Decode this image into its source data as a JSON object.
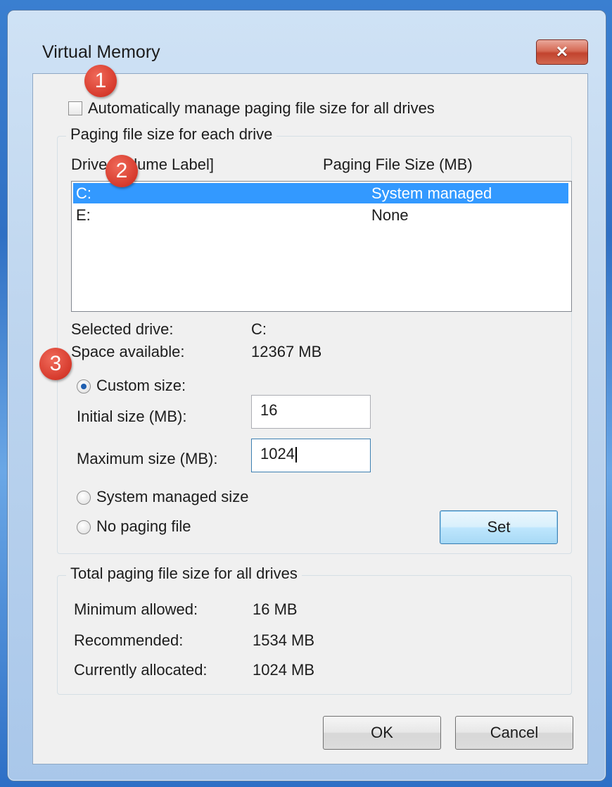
{
  "window": {
    "title": "Virtual Memory",
    "close_label": "✕"
  },
  "auto_manage": {
    "label": "Automatically manage paging file size for all drives",
    "checked": false
  },
  "paging_group": {
    "label": "Paging file size for each drive",
    "col_drive": "Drive [Volume Label]",
    "col_size": "Paging File Size (MB)",
    "rows": [
      {
        "drive": "C:",
        "size": "System managed",
        "selected": true
      },
      {
        "drive": "E:",
        "size": "None",
        "selected": false
      }
    ],
    "selected_drive_label": "Selected drive:",
    "selected_drive_value": "C:",
    "space_label": "Space available:",
    "space_value": "12367 MB",
    "custom_size_label": "Custom size:",
    "initial_label": "Initial size (MB):",
    "initial_value": "16",
    "max_label": "Maximum size (MB):",
    "max_value": "1024",
    "system_managed_label": "System managed size",
    "no_paging_label": "No paging file",
    "set_label": "Set"
  },
  "total_group": {
    "label": "Total paging file size for all drives",
    "min_label": "Minimum allowed:",
    "min_value": "16 MB",
    "rec_label": "Recommended:",
    "rec_value": "1534 MB",
    "cur_label": "Currently allocated:",
    "cur_value": "1024 MB"
  },
  "buttons": {
    "ok": "OK",
    "cancel": "Cancel"
  },
  "badges": [
    "1",
    "2",
    "3"
  ]
}
